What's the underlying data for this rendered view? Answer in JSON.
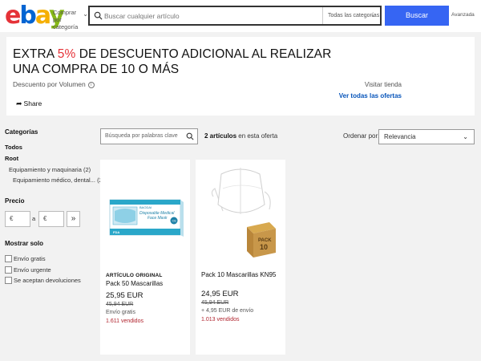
{
  "header": {
    "logo": {
      "e": "e",
      "b": "b",
      "a": "a",
      "y": "y"
    },
    "shop_by_category": "Comprar por categoría",
    "search_placeholder": "Buscar cualquier artículo",
    "category_select": "Todas las categorías",
    "search_button": "Buscar",
    "advanced": "Avanzada"
  },
  "banner": {
    "title_prefix": "EXTRA ",
    "title_accent": "5%",
    "title_rest": " DE DESCUENTO ADICIONAL AL REALIZAR",
    "title_line2": "UNA COMPRA DE 10 O MÁS",
    "subtitle": "Descuento por Volumen",
    "share": "Share",
    "visit_store": "Visitar tienda",
    "all_offers": "Ver todas las ofertas"
  },
  "sidebar": {
    "categories_title": "Categorías",
    "all": "Todos",
    "root": "Root",
    "items": [
      {
        "label": "Equipamiento y maquinaria",
        "count": "(2)"
      },
      {
        "label": "Equipamiento médico, dental...",
        "count": "(2)"
      }
    ],
    "price_title": "Precio",
    "price_min": "€",
    "price_to": "a",
    "price_max": "€",
    "show_only_title": "Mostrar solo",
    "filters": [
      "Envío gratis",
      "Envío urgente",
      "Se aceptan devoluciones"
    ]
  },
  "results": {
    "keyword_placeholder": "Búsqueda por palabras clave",
    "count": "2 artículos",
    "count_suffix": " en esta oferta",
    "sort_label": "Ordenar por:",
    "sort_value": "Relevancia"
  },
  "products": [
    {
      "tag": "ARTÍCULO ORIGINAL",
      "title": "Pack 50 Mascarillas",
      "price": "25,95 EUR",
      "old_price": "45,94 EUR",
      "shipping": "Envío gratis",
      "sold": "1.611 vendidos",
      "image_text": {
        "brand": "BAODAI",
        "line1": "Disposable Medical",
        "line2": "Face Mask",
        "ce": "CE",
        "fda": "FDA"
      }
    },
    {
      "title": "Pack 10 Mascarillas KN95",
      "price": "24,95 EUR",
      "old_price": "45,94 EUR",
      "shipping": "+ 4,95 EUR de envío",
      "sold": "1.013 vendidos",
      "image_text": {
        "box_line1": "PACK",
        "box_line2": "10"
      }
    }
  ],
  "colors": {
    "search_button": "#3665f3",
    "link": "#0654ba",
    "sold": "#b0242e",
    "accent": "#e53238"
  }
}
